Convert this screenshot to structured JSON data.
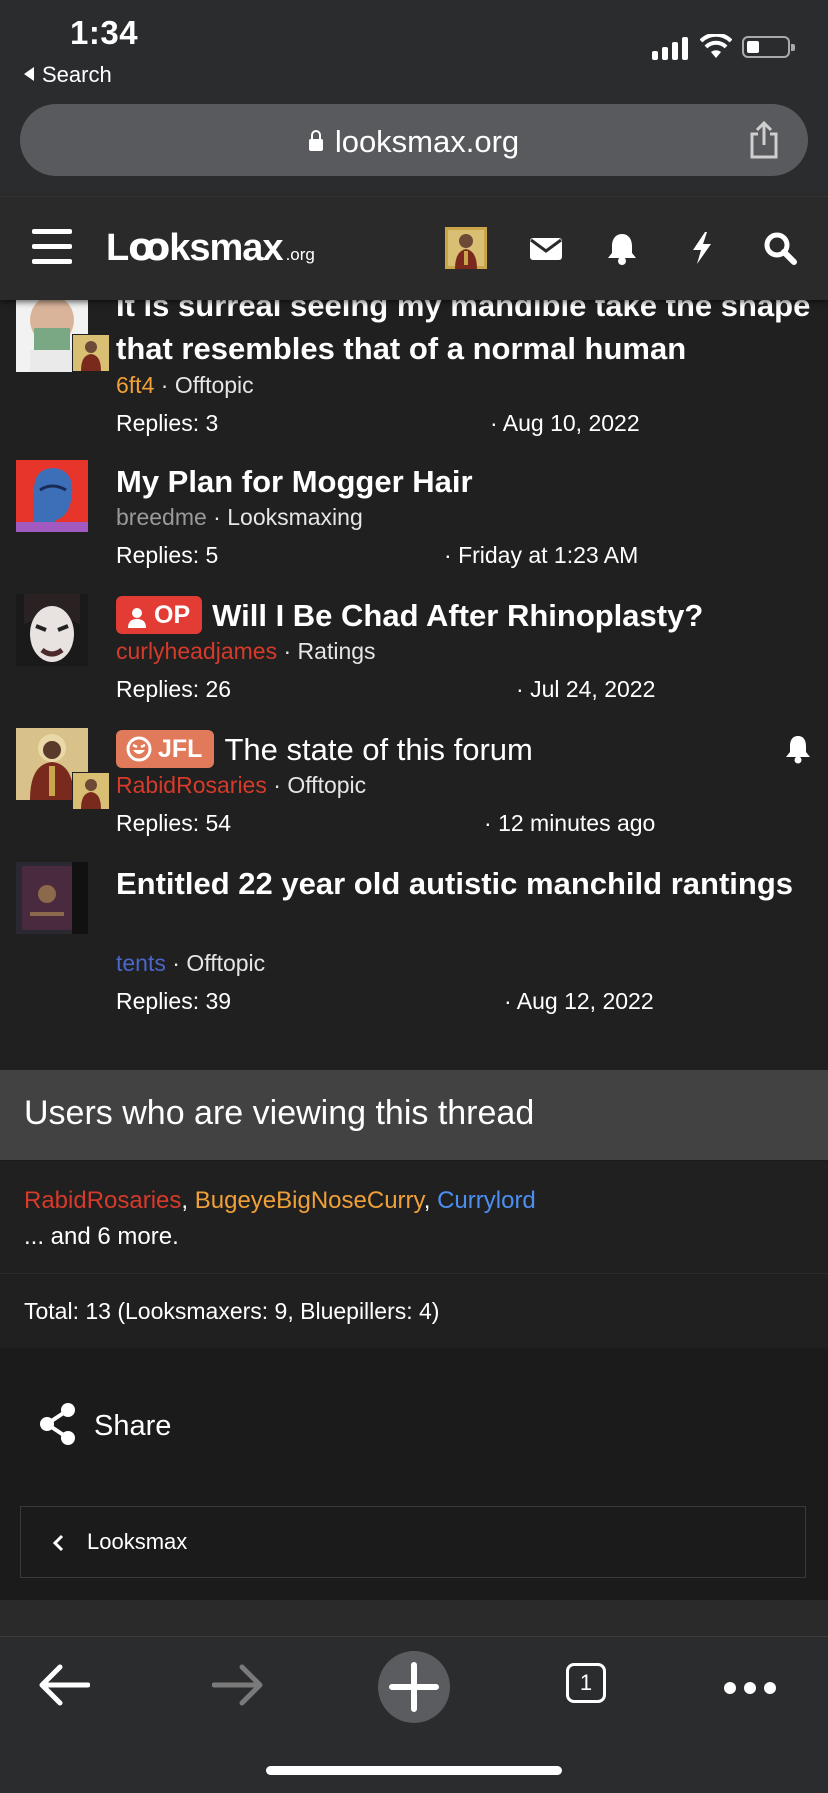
{
  "status": {
    "time": "1:34",
    "back_label": "Search"
  },
  "browser": {
    "url": "looksmax.org",
    "tab_count": "1"
  },
  "site": {
    "logo": "Lꝏksmax",
    "logo_suffix": ".org"
  },
  "threads": [
    {
      "title": "It is surreal seeing my mandible take the shape that resembles that of a normal human",
      "author": "6ft4",
      "author_color": "#f0a038",
      "forum": "Offtopic",
      "replies": "Replies: 3",
      "date": "Aug 10, 2022"
    },
    {
      "title": "My Plan for Mogger Hair",
      "author": "breedme",
      "author_color": "#9a9a9a",
      "forum": "Looksmaxing",
      "replies": "Replies: 5",
      "date": "Friday at 1:23 AM"
    },
    {
      "prefix": "OP",
      "prefix_color": "#e23c34",
      "title": "Will I Be Chad After Rhinoplasty?",
      "author": "curlyheadjames",
      "author_color": "#d63a2a",
      "forum": "Ratings",
      "replies": "Replies: 26",
      "date": "Jul 24, 2022"
    },
    {
      "prefix": "JFL",
      "prefix_color": "#e07a5a",
      "title": "The state of this forum",
      "author": "RabidRosaries",
      "author_color": "#d63a2a",
      "forum": "Offtopic",
      "replies": "Replies: 54",
      "date": "12 minutes ago"
    },
    {
      "title": "Entitled 22 year old autistic manchild rantings",
      "author": "tents",
      "author_color": "#4a66c9",
      "forum": "Offtopic",
      "replies": "Replies: 39",
      "date": "Aug 12, 2022"
    }
  ],
  "viewing": {
    "heading": "Users who are viewing this thread",
    "users": [
      {
        "name": "RabidRosaries",
        "color": "#d63a2a"
      },
      {
        "name": "BugeyeBigNoseCurry",
        "color": "#f0a038"
      },
      {
        "name": "Currylord",
        "color": "#4b8ff0"
      }
    ],
    "more": "... and 6 more.",
    "total": "Total: 13 (Looksmaxers: 9, Bluepillers: 4)"
  },
  "share_label": "Share",
  "breadcrumb": "Looksmax"
}
